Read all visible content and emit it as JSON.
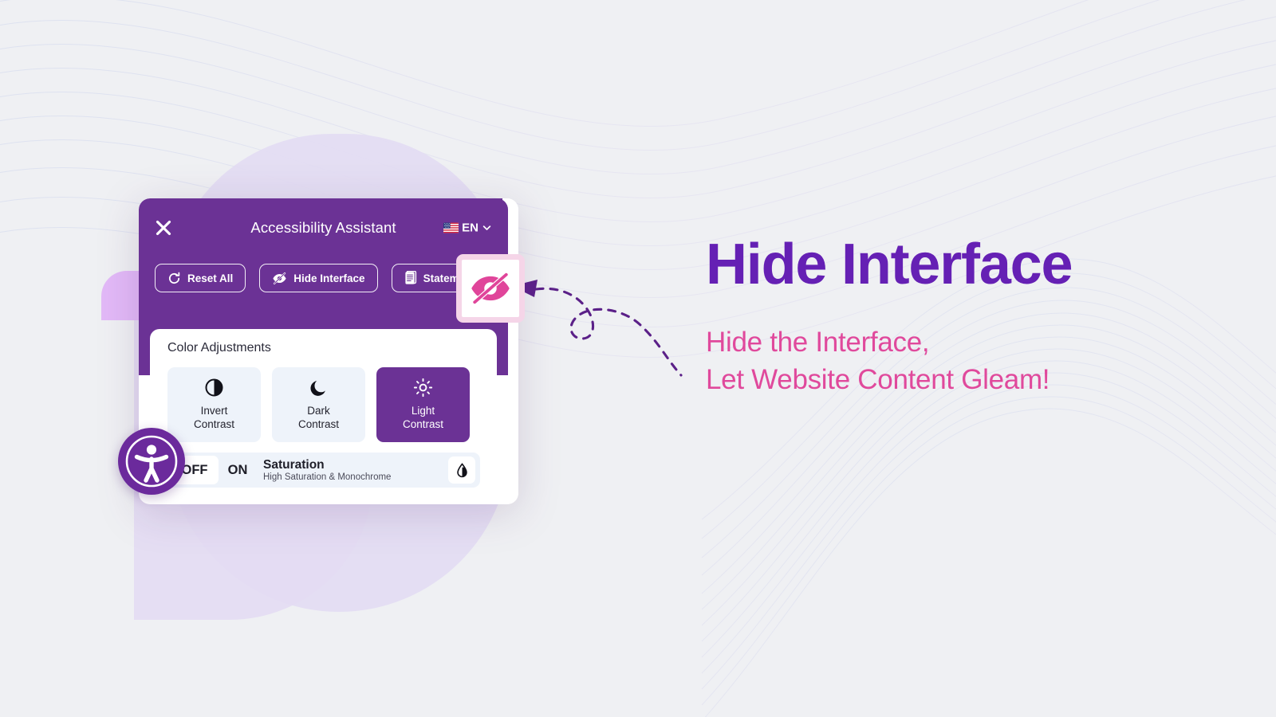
{
  "theme": {
    "page_bg": "#eff0f3",
    "panel_purple": "#6b3295",
    "heading_purple": "#6520b4",
    "accent_pink": "#e0499c",
    "tile_bg": "#eef3fa",
    "callout_frame": "#f5d5e8"
  },
  "panel": {
    "title": "Accessibility Assistant",
    "close_label": "×",
    "language": {
      "code": "EN",
      "flag": "us-flag-icon",
      "chevron": "chevron-down-icon"
    },
    "quick_actions": [
      {
        "label": "Reset All",
        "icon": "reset-icon"
      },
      {
        "label": "Hide Interface",
        "icon": "eye-slash-icon"
      },
      {
        "label": "Statement",
        "icon": "document-icon"
      }
    ],
    "section": {
      "title": "Color Adjustments",
      "tiles": [
        {
          "label_line1": "Invert",
          "label_line2": "Contrast",
          "icon": "contrast-half-circle-icon",
          "active": false
        },
        {
          "label_line1": "Dark",
          "label_line2": "Contrast",
          "icon": "moon-icon",
          "active": false
        },
        {
          "label_line1": "Light",
          "label_line2": "Contrast",
          "icon": "sun-icon",
          "active": true
        }
      ]
    },
    "saturation_row": {
      "toggle_off_label": "OFF",
      "toggle_on_label": "ON",
      "name": "Saturation",
      "description": "High Saturation & Monochrome",
      "icon": "droplet-icon",
      "state": "OFF"
    },
    "fab_icon": "accessibility-person-icon"
  },
  "callout": {
    "icon": "eye-slash-icon",
    "arrow": "dashed-loop-arrow"
  },
  "hero": {
    "heading": "Hide Interface",
    "subtitle_line1": "Hide the Interface,",
    "subtitle_line2": "Let Website Content Gleam!"
  }
}
